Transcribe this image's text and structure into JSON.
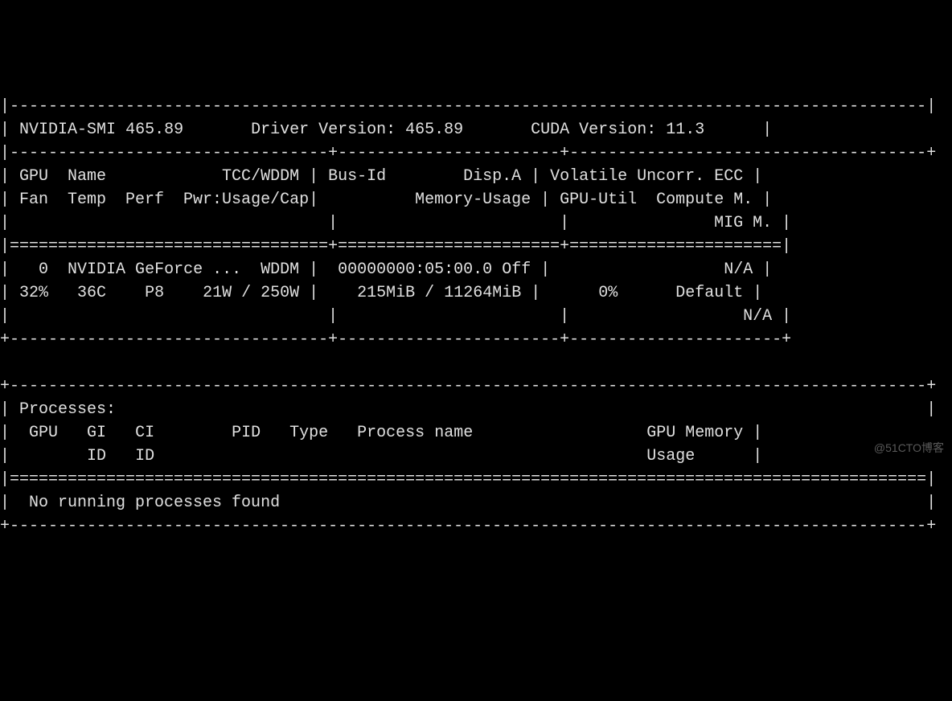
{
  "header": {
    "smi_label": "NVIDIA-SMI",
    "smi_version": "465.89",
    "driver_label": "Driver Version:",
    "driver_version": "465.89",
    "cuda_label": "CUDA Version:",
    "cuda_version": "11.3"
  },
  "col_headers": {
    "c1_row1": "GPU  Name            TCC/WDDM",
    "c1_row2": "Fan  Temp  Perf  Pwr:Usage/Cap",
    "c2_row1": "Bus-Id        Disp.A",
    "c2_row2": "Memory-Usage",
    "c3_row1": "Volatile Uncorr. ECC",
    "c3_row2": "GPU-Util  Compute M.",
    "c3_row3": "MIG M."
  },
  "gpu": {
    "index": "0",
    "name": "NVIDIA GeForce ...",
    "mode": "WDDM",
    "fan": "32%",
    "temp": "36C",
    "perf": "P8",
    "pwr": "21W / 250W",
    "bus_id": "00000000:05:00.0",
    "disp_a": "Off",
    "mem_used": "215MiB",
    "mem_total": "11264MiB",
    "util": "0%",
    "ecc": "N/A",
    "compute_m": "Default",
    "mig_m": "N/A"
  },
  "processes": {
    "title": "Processes:",
    "hdr_gpu": "GPU",
    "hdr_gi": "GI",
    "hdr_ci": "CI",
    "hdr_pid": "PID",
    "hdr_type": "Type",
    "hdr_pname": "Process name",
    "hdr_mem": "GPU Memory",
    "hdr_id": "ID",
    "hdr_usage": "Usage",
    "none": "No running processes found"
  },
  "watermark": "@51CTO博客"
}
